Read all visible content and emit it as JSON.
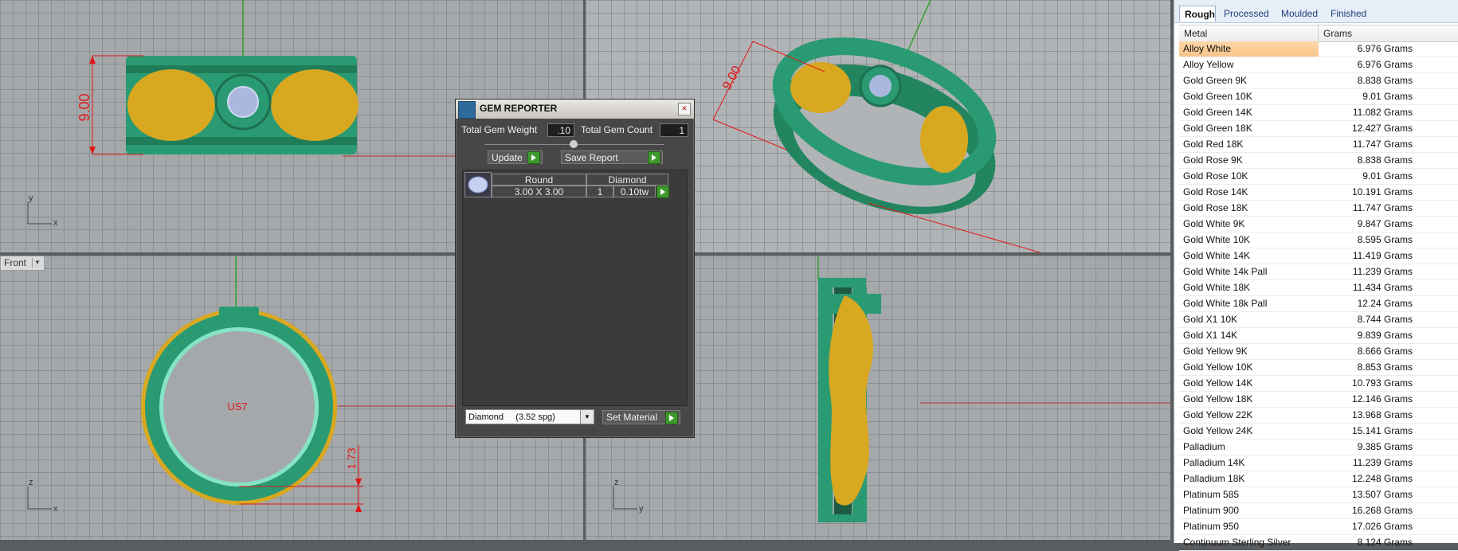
{
  "viewports": {
    "top_dimension": "9.00",
    "persp_dimension": "9.00",
    "front_label": "Front",
    "front_dimension": "1.73",
    "front_center_label": "US7",
    "axes": {
      "top": {
        "v": "y",
        "h": "x"
      },
      "front": {
        "v": "z",
        "h": "x"
      },
      "right": {
        "v": "z",
        "h": "y"
      }
    }
  },
  "gem_reporter": {
    "title": "GEM REPORTER",
    "total_weight_label": "Total Gem Weight",
    "total_weight_value": ".10",
    "total_count_label": "Total Gem Count",
    "total_count_value": "1",
    "update_label": "Update",
    "save_report_label": "Save Report",
    "gem": {
      "shape": "Round",
      "material": "Diamond",
      "size": "3.00 X 3.00",
      "count": "1",
      "weight": "0.10tw"
    },
    "material_select": "Diamond     (3.52 spg)",
    "set_material_label": "Set Material"
  },
  "metal_panel": {
    "tabs": [
      "Rough",
      "Processed",
      "Moulded",
      "Finished"
    ],
    "active_tab": "Rough",
    "columns": [
      "Metal",
      "Grams"
    ],
    "rows": [
      {
        "metal": "Alloy White",
        "grams": "6.976 Grams"
      },
      {
        "metal": "Alloy Yellow",
        "grams": "6.976 Grams"
      },
      {
        "metal": "Gold Green 9K",
        "grams": "8.838 Grams"
      },
      {
        "metal": "Gold Green 10K",
        "grams": "9.01 Grams"
      },
      {
        "metal": "Gold Green 14K",
        "grams": "11.082 Grams"
      },
      {
        "metal": "Gold Green 18K",
        "grams": "12.427 Grams"
      },
      {
        "metal": "Gold Red 18K",
        "grams": "11.747 Grams"
      },
      {
        "metal": "Gold Rose 9K",
        "grams": "8.838 Grams"
      },
      {
        "metal": "Gold Rose 10K",
        "grams": "9.01 Grams"
      },
      {
        "metal": "Gold Rose 14K",
        "grams": "10.191 Grams"
      },
      {
        "metal": "Gold Rose 18K",
        "grams": "11.747 Grams"
      },
      {
        "metal": "Gold White 9K",
        "grams": "9.847 Grams"
      },
      {
        "metal": "Gold White 10K",
        "grams": "8.595 Grams"
      },
      {
        "metal": "Gold White 14K",
        "grams": "11.419 Grams"
      },
      {
        "metal": "Gold White 14k Pall",
        "grams": "11.239 Grams"
      },
      {
        "metal": "Gold White 18K",
        "grams": "11.434 Grams"
      },
      {
        "metal": "Gold White 18k Pall",
        "grams": "12.24 Grams"
      },
      {
        "metal": "Gold X1 10K",
        "grams": "8.744 Grams"
      },
      {
        "metal": "Gold X1 14K",
        "grams": "9.839 Grams"
      },
      {
        "metal": "Gold Yellow 9K",
        "grams": "8.666 Grams"
      },
      {
        "metal": "Gold Yellow 10K",
        "grams": "8.853 Grams"
      },
      {
        "metal": "Gold Yellow 14K",
        "grams": "10.793 Grams"
      },
      {
        "metal": "Gold Yellow 18K",
        "grams": "12.146 Grams"
      },
      {
        "metal": "Gold Yellow 22K",
        "grams": "13.968 Grams"
      },
      {
        "metal": "Gold Yellow 24K",
        "grams": "15.141 Grams"
      },
      {
        "metal": "Palladium",
        "grams": "9.385 Grams"
      },
      {
        "metal": "Palladium 14K",
        "grams": "11.239 Grams"
      },
      {
        "metal": "Palladium 18K",
        "grams": "12.248 Grams"
      },
      {
        "metal": "Platinum 585",
        "grams": "13.507 Grams"
      },
      {
        "metal": "Platinum 900",
        "grams": "16.268 Grams"
      },
      {
        "metal": "Platinum 950",
        "grams": "17.026 Grams"
      },
      {
        "metal": "Continuum Sterling Silver",
        "grams": "8.124 Grams"
      }
    ]
  },
  "colors": {
    "ring_green": "#2a9a72",
    "ring_gold": "#d8a820",
    "dimension_red": "#e01818",
    "axis_green": "#2fa02f"
  }
}
